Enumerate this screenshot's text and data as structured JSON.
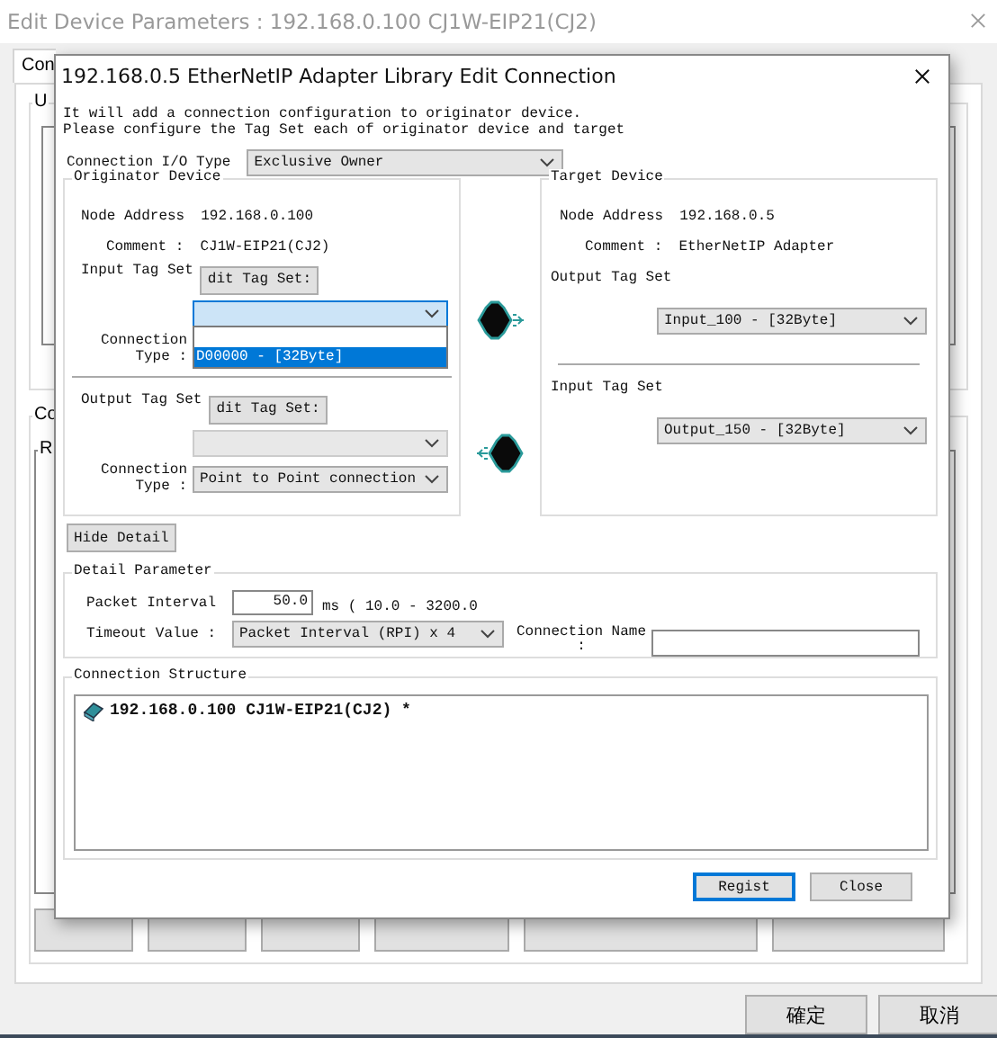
{
  "background_window": {
    "title": "Edit Device Parameters : 192.168.0.100 CJ1W-EIP21(CJ2)",
    "tabs": [
      {
        "label": "Con",
        "selected": true
      }
    ],
    "group_labels": [
      "U",
      "Co",
      "R"
    ],
    "buttons": [
      "確定",
      "取消"
    ]
  },
  "dialog": {
    "title": "192.168.0.5 EtherNetIP Adapter Library Edit Connection",
    "intro": [
      "It will add a connection configuration to originator device.",
      "Please configure the Tag Set each of originator device and target"
    ],
    "io_type": {
      "label": "Connection I/O Type",
      "value": "Exclusive Owner"
    },
    "originator": {
      "title": "Originator Device",
      "node_label": "Node Address",
      "node": "192.168.0.100",
      "comment_label": "Comment :",
      "comment": "CJ1W-EIP21(CJ2)",
      "input": {
        "label": "Input Tag Set",
        "edit_button": "dit Tag Set:",
        "open": true,
        "disabled": false,
        "options": [
          {
            "selected": false
          },
          {
            "label": "D00000 - [32Byte]",
            "selected": true
          }
        ],
        "conn_label": [
          "Connection",
          "Type :"
        ]
      },
      "output": {
        "label": "Output Tag Set",
        "edit_button": "dit Tag Set:",
        "open": false,
        "disabled": true,
        "conn_label": [
          "Connection",
          "Type :"
        ],
        "conn_type": "Point to Point connection"
      }
    },
    "target": {
      "title": "Target Device",
      "node_label": "Node Address",
      "node": "192.168.0.5",
      "comment_label": "Comment :",
      "comment": "EtherNetIP Adapter",
      "output_label": "Output Tag Set",
      "output_tag": "Input_100 - [32Byte]",
      "input_label": "Input Tag Set",
      "input_tag": "Output_150 - [32Byte]"
    },
    "hide_detail_button": "Hide Detail",
    "detail": {
      "title": "Detail Parameter",
      "packet_interval_label": "Packet Interval",
      "packet_interval": "50.0",
      "range": "ms ( 10.0 - 3200.0",
      "timeout_label": "Timeout Value :",
      "timeout": "Packet Interval (RPI) x 4",
      "connection_name_label": [
        "Connection Name",
        ":"
      ]
    },
    "structure": {
      "title": "Connection Structure",
      "items": [
        "192.168.0.100 CJ1W-EIP21(CJ2) *"
      ]
    },
    "buttons": [
      {
        "label": "Regist",
        "default": true
      },
      {
        "label": "Close",
        "default": false
      }
    ]
  }
}
